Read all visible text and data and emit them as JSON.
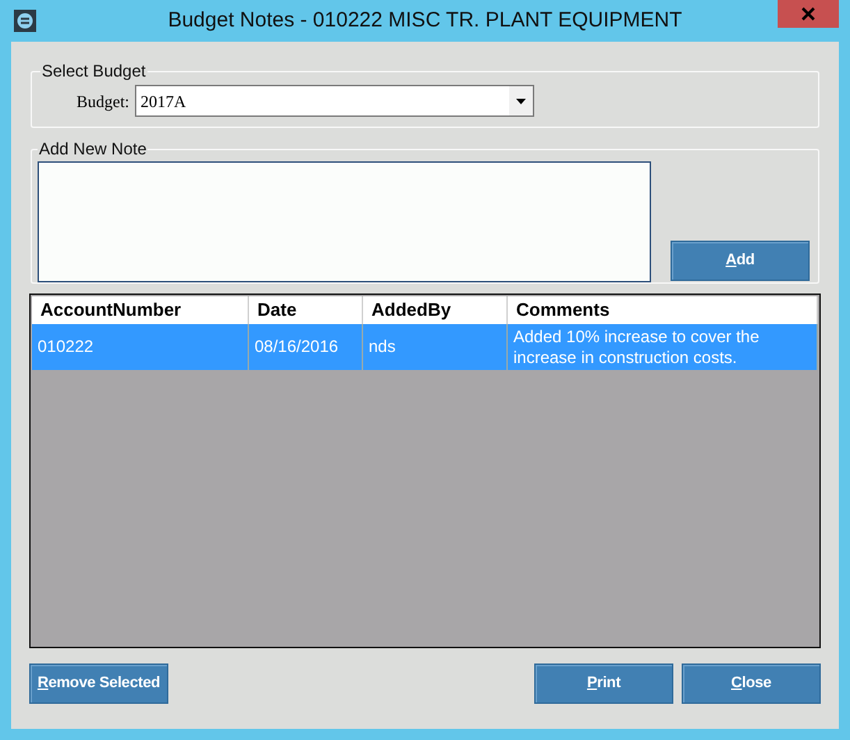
{
  "window": {
    "title": "Budget Notes - 010222 MISC TR. PLANT EQUIPMENT"
  },
  "select_budget": {
    "legend": "Select Budget",
    "label": "Budget:",
    "value": "2017A"
  },
  "add_note": {
    "legend": "Add New Note",
    "button": "Add"
  },
  "table": {
    "columns": [
      "AccountNumber",
      "Date",
      "AddedBy",
      "Comments"
    ],
    "rows": [
      {
        "selected": true,
        "cells": [
          "010222",
          "08/16/2016",
          "nds",
          "Added 10% increase to cover the increase in construction costs."
        ]
      }
    ]
  },
  "buttons": [
    {
      "label": "Remove Selected"
    },
    {
      "label": "Print"
    },
    {
      "label": "Close"
    }
  ]
}
